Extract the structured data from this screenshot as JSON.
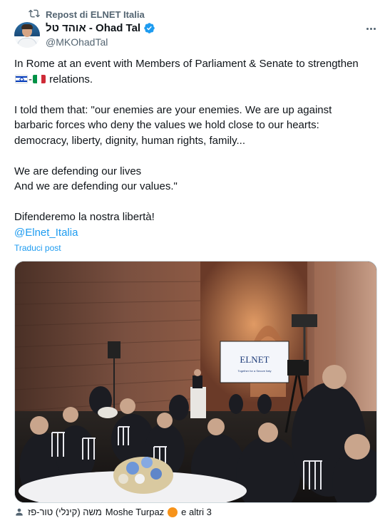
{
  "repost": {
    "label": "Repost di ELNET Italia",
    "icon": "repost-icon"
  },
  "author": {
    "display_name": "אוהד טל - Ohad Tal",
    "handle": "@MKOhadTal",
    "verified_color": "#1d9bf0"
  },
  "tweet": {
    "line1": "In Rome at an event with Members of Parliament & Senate to strengthen",
    "line2_suffix": "relations.",
    "line2_separator": "-",
    "para2_line1": "I told them that: \"our enemies are your enemies. We are up against",
    "para2_line2": "barbaric forces who deny the values we hold close to our hearts:",
    "para2_line3": "democracy, liberty, dignity, human rights, family...",
    "para3_line1": "We are defending our lives",
    "para3_line2": "And we are defending our values.\"",
    "para4_line1": "Difenderemo la nostra libertà!",
    "mention": "@Elnet_Italia"
  },
  "translate_label": "Traduci post",
  "photo": {
    "screen_logo": "ELNET",
    "screen_subtitle": "Together for a Secure Italy"
  },
  "footer": {
    "tagged_hebrew": "משה (קינלי) טור-פז",
    "tagged_name": "Moshe Turpaz",
    "others": "e altri 3"
  },
  "colors": {
    "accent": "#1d9bf0",
    "secondary_text": "#536471",
    "text": "#0f1419"
  }
}
